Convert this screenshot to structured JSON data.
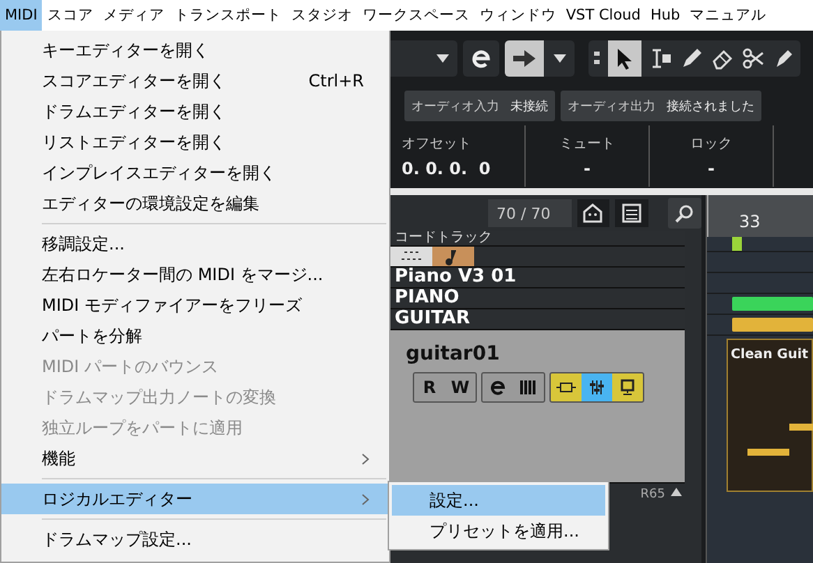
{
  "menubar": [
    {
      "label": "MIDI",
      "selected": true
    },
    {
      "label": "スコア",
      "selected": false
    },
    {
      "label": "メディア",
      "selected": false
    },
    {
      "label": "トランスポート",
      "selected": false
    },
    {
      "label": "スタジオ",
      "selected": false
    },
    {
      "label": "ワークスペース",
      "selected": false
    },
    {
      "label": "ウィンドウ",
      "selected": false
    },
    {
      "label": "VST Cloud",
      "selected": false
    },
    {
      "label": "Hub",
      "selected": false
    },
    {
      "label": "マニュアル",
      "selected": false
    }
  ],
  "menu": [
    {
      "kind": "item",
      "label": "キーエディターを開く",
      "disabled": false,
      "selected": false
    },
    {
      "kind": "item",
      "label": "スコアエディターを開く",
      "shortcut": "Ctrl+R",
      "disabled": false,
      "selected": false
    },
    {
      "kind": "item",
      "label": "ドラムエディターを開く",
      "disabled": false,
      "selected": false
    },
    {
      "kind": "item",
      "label": "リストエディターを開く",
      "disabled": false,
      "selected": false
    },
    {
      "kind": "item",
      "label": "インプレイスエディターを開く",
      "disabled": false,
      "selected": false
    },
    {
      "kind": "item",
      "label": "エディターの環境設定を編集",
      "disabled": false,
      "selected": false
    },
    {
      "kind": "separator"
    },
    {
      "kind": "item",
      "label": "移調設定...",
      "disabled": false,
      "selected": false
    },
    {
      "kind": "item",
      "label": "左右ロケーター間の MIDI をマージ...",
      "disabled": false,
      "selected": false
    },
    {
      "kind": "item",
      "label": "MIDI モディファイアーをフリーズ",
      "disabled": false,
      "selected": false
    },
    {
      "kind": "item",
      "label": "パートを分解",
      "disabled": false,
      "selected": false
    },
    {
      "kind": "item",
      "label": "MIDI パートのバウンス",
      "disabled": true,
      "selected": false
    },
    {
      "kind": "item",
      "label": "ドラムマップ出力ノートの変換",
      "disabled": true,
      "selected": false
    },
    {
      "kind": "item",
      "label": "独立ループをパートに適用",
      "disabled": true,
      "selected": false
    },
    {
      "kind": "submenu",
      "label": "機能",
      "disabled": false,
      "selected": false
    },
    {
      "kind": "separator"
    },
    {
      "kind": "submenu",
      "label": "ロジカルエディター",
      "disabled": false,
      "selected": true
    },
    {
      "kind": "separator"
    },
    {
      "kind": "item",
      "label": "ドラムマップ設定...",
      "disabled": false,
      "selected": false
    }
  ],
  "submenu": [
    {
      "label": "設定...",
      "selected": true
    },
    {
      "label": "プリセットを適用...",
      "selected": false
    }
  ],
  "routing": [
    {
      "kind": "label",
      "text": "オーディオ入力"
    },
    {
      "kind": "value",
      "text": "未接続"
    },
    {
      "kind": "label",
      "text": "オーディオ出力"
    },
    {
      "kind": "value",
      "text": "接続されました"
    }
  ],
  "info": [
    {
      "label": "オフセット",
      "value": "0. 0. 0.  0"
    },
    {
      "label": "ミュート",
      "value": "-"
    },
    {
      "label": "ロック",
      "value": "-"
    }
  ],
  "track_count": "70 / 70",
  "ruler": "33",
  "tracks": [
    {
      "kind": "chord",
      "name": "コードトラック",
      "selected": false
    },
    {
      "kind": "icons",
      "selected": false
    },
    {
      "kind": "folder",
      "name": "Piano V3 01",
      "selected": false
    },
    {
      "kind": "folder",
      "name": "PIANO",
      "selected": false
    },
    {
      "kind": "folder",
      "name": "GUITAR",
      "selected": false
    },
    {
      "kind": "instrument",
      "name": "guitar01",
      "selected": true,
      "buttons": [
        "R",
        "W"
      ]
    }
  ],
  "lower_header": "R65",
  "part_name": "Clean Guit"
}
